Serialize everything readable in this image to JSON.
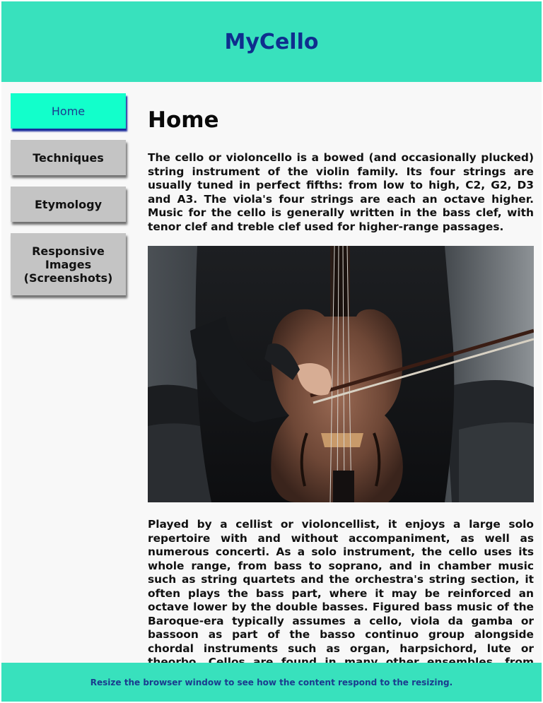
{
  "site": {
    "title": "MyCello"
  },
  "sidebar": {
    "items": [
      {
        "label": "Home",
        "active": true
      },
      {
        "label": "Techniques",
        "active": false
      },
      {
        "label": "Etymology",
        "active": false
      },
      {
        "label": "Responsive Images (Screenshots)",
        "active": false
      }
    ]
  },
  "main": {
    "heading": "Home",
    "paragraphs": [
      "The cello or violoncello is a bowed (and occasionally plucked) string instrument of the violin family. Its four strings are usually tuned in perfect fifths: from low to high, C2, G2, D3 and A3. The viola's four strings are each an octave higher. Music for the cello is generally written in the bass clef, with tenor clef and treble clef used for higher-range passages.",
      "Played by a cellist or violoncellist, it enjoys a large solo repertoire with and without accompaniment, as well as numerous concerti. As a solo instrument, the cello uses its whole range, from bass to soprano, and in chamber music such as string quartets and the orchestra's string section, it often plays the bass part, where it may be reinforced an octave lower by the double basses. Figured bass music of the Baroque-era typically assumes a cello, viola da gamba or bassoon as part of the basso continuo group alongside chordal instruments such as organ, harpsichord, lute or theorbo. Cellos are found in many other ensembles, from modern Chinese orchestras to cello rock"
    ],
    "image_subject": "cello-photo"
  },
  "footer": {
    "text": "Resize the browser window to see how the content respond to the resizing."
  },
  "colors": {
    "header_bg": "#38e1bd",
    "title": "#0f2e8e",
    "active_nav": "#12ffcb",
    "inactive_nav": "#c4c4c4",
    "footer_bg": "#38e1bd"
  }
}
